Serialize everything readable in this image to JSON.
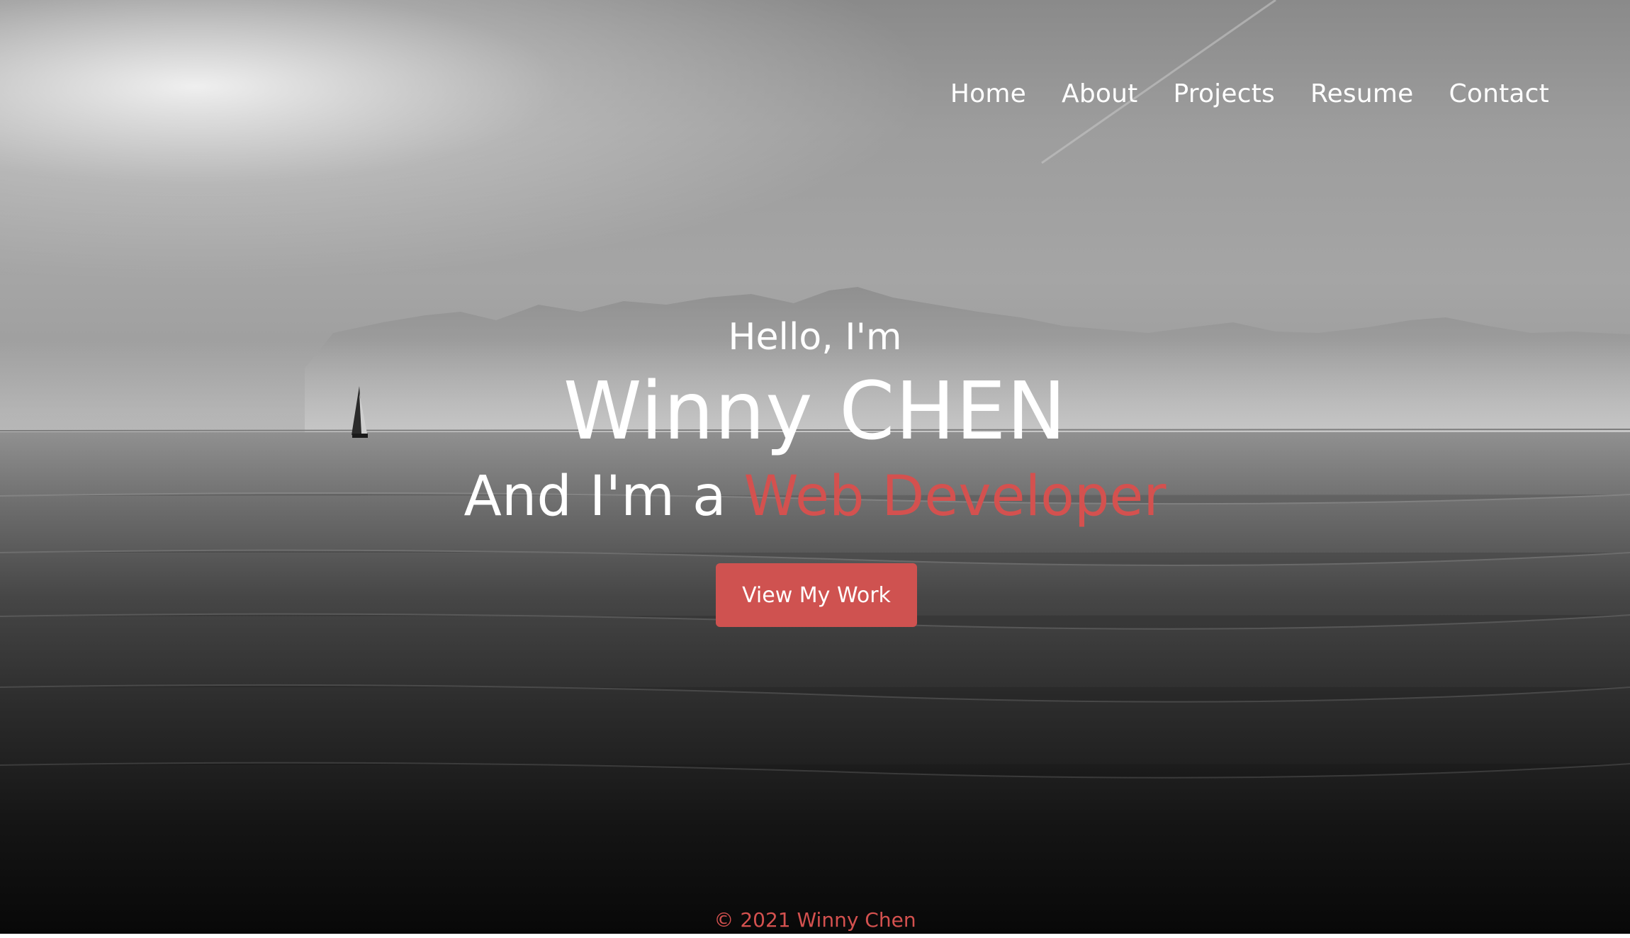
{
  "nav": {
    "items": [
      {
        "label": "Home"
      },
      {
        "label": "About"
      },
      {
        "label": "Projects"
      },
      {
        "label": "Resume"
      },
      {
        "label": "Contact"
      }
    ]
  },
  "hero": {
    "greeting": "Hello, I'm",
    "name": "Winny CHEN",
    "role_prefix": "And I'm a ",
    "role_highlight": "Web Developer",
    "cta_label": "View My Work"
  },
  "footer": {
    "copyright": "© 2021 Winny Chen"
  },
  "colors": {
    "accent": "#d4514f",
    "button": "#cf5250",
    "text": "#ffffff"
  },
  "icons": {
    "sailboat": "sailboat-icon"
  }
}
